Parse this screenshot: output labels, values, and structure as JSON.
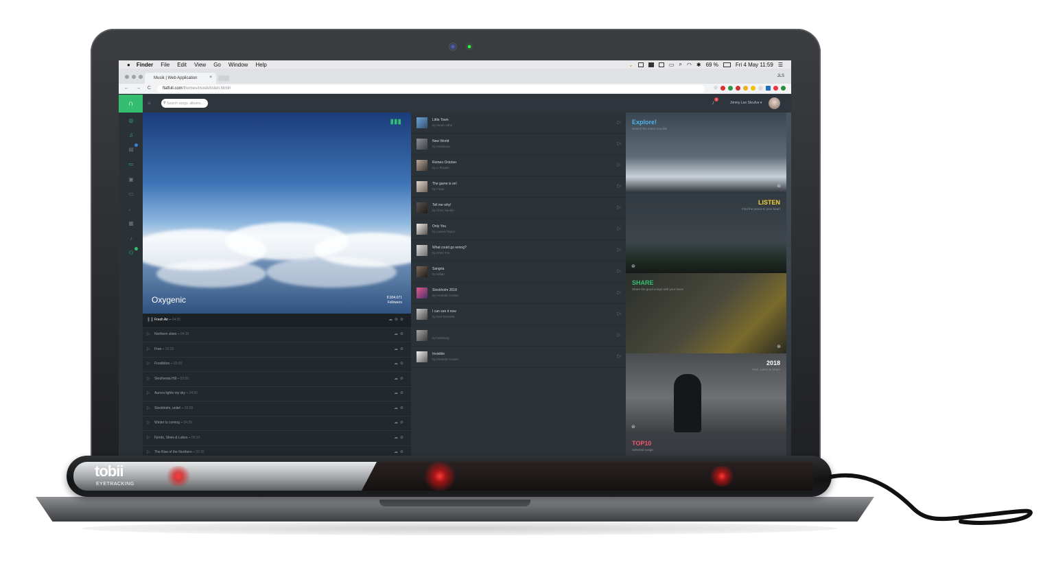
{
  "menubar": {
    "apple": "",
    "items": [
      "Finder",
      "File",
      "Edit",
      "View",
      "Go",
      "Window",
      "Help"
    ],
    "battery": "69 %",
    "datetime": "Fri 4 May  11:59"
  },
  "browser": {
    "tab_title": "Musik | Web Application",
    "tab_close": "×",
    "profile": "JLS",
    "url_host": "flatfull.com",
    "url_path": "/themes/musik/listen.html#",
    "nav_glyphs": "← → C ⌂"
  },
  "app": {
    "search_placeholder": "Search songs, albums...",
    "notification_count": "1",
    "user_name": "Jimmy Lee Skrufve ▾",
    "hero": {
      "title": "Oxygenic",
      "followers_count": "8.904.071",
      "followers_label": "Followers"
    },
    "tracks": [
      {
        "name": "Fresh Air",
        "duration": "04:35",
        "active": true
      },
      {
        "name": "Northern skies",
        "duration": "04:15"
      },
      {
        "name": "Free",
        "duration": "02:25"
      },
      {
        "name": "Frostbiten",
        "duration": "05:00"
      },
      {
        "name": "Skrufvesta Hill",
        "duration": "03:50"
      },
      {
        "name": "Aurora lights my sky",
        "duration": "04:05"
      },
      {
        "name": "Stockholm, unite!",
        "duration": "02:55"
      },
      {
        "name": "Winter is coming",
        "duration": "04:35"
      },
      {
        "name": "Fjords, Skies & Lakes",
        "duration": "05:10"
      },
      {
        "name": "The Rise of the Northern",
        "duration": "02:35"
      }
    ],
    "songs": [
      {
        "title": "Little Town",
        "artist": "by Steph Adhe"
      },
      {
        "title": "New World",
        "artist": "by Anastasia"
      },
      {
        "title": "Romeo October",
        "artist": "by Li Rousin"
      },
      {
        "title": "The game is on!",
        "artist": "by Foam"
      },
      {
        "title": "Tell me why!",
        "artist": "by Chris Sandie"
      },
      {
        "title": "Only You",
        "artist": "by Lauren Taylor"
      },
      {
        "title": "What could go wrong?",
        "artist": "by Chris Fox"
      },
      {
        "title": "Sangria",
        "artist": "by Millan"
      },
      {
        "title": "Stockholm 2018",
        "artist": "by Amanda Conlan"
      },
      {
        "title": "I can see it now",
        "artist": "by Dan Doerzek"
      },
      {
        "title": "",
        "artist": "by Hamburg"
      },
      {
        "title": "Invisible",
        "artist": "by Amanda Conlan"
      }
    ],
    "explore_cards": [
      {
        "heading": "Explore!",
        "sub": "Search the music you like",
        "color": "#4fb3e6"
      },
      {
        "heading": "LISTEN",
        "sub": "Find the peace in your heart",
        "color": "#f2d233"
      },
      {
        "heading": "SHARE",
        "sub": "Share the good songs with your loves",
        "color": "#34bd70"
      },
      {
        "heading": "2018",
        "sub": "Feel, Listen & Share",
        "color": "#ffffff"
      },
      {
        "heading": "TOP10",
        "sub": "Selected songs",
        "color": "#f0566b"
      }
    ]
  },
  "device": {
    "brand": "tobii",
    "sub": "EYETRACKING"
  }
}
